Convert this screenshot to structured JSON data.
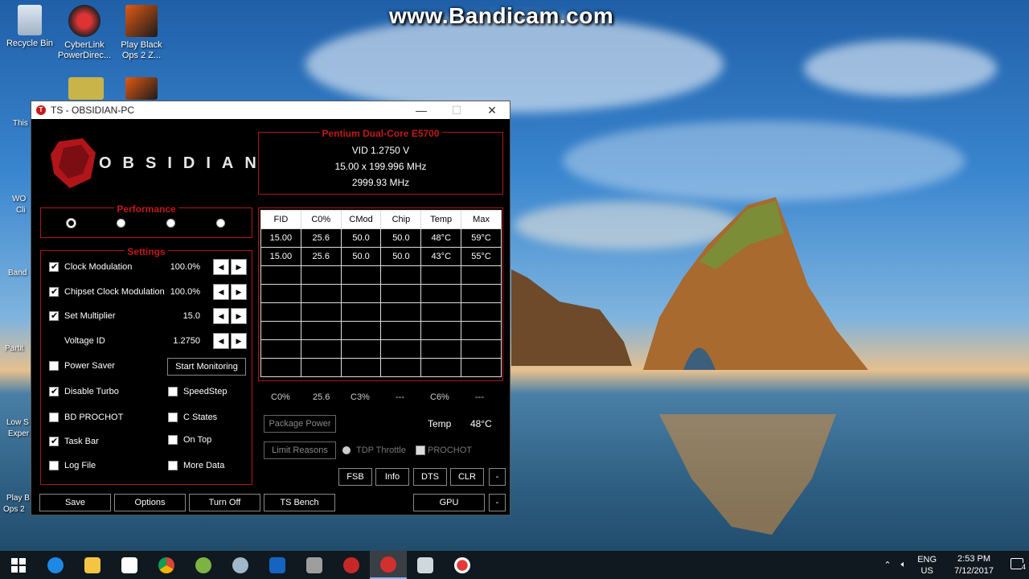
{
  "watermark": "www.Bandicam.com",
  "desktop_icons": [
    {
      "label_line1": "Recycle Bin",
      "label_line2": "",
      "icon": "recycle-bin-icon"
    },
    {
      "label_line1": "CyberLink",
      "label_line2": "PowerDirec...",
      "icon": "cyberlink-icon"
    },
    {
      "label_line1": "Play Black",
      "label_line2": "Ops 2 Z...",
      "icon": "black-ops-icon"
    }
  ],
  "partial_labels": [
    "This",
    "WO",
    "Cli",
    "Band",
    "Partit",
    "Low S",
    "Exper",
    "Play B",
    "Ops 2"
  ],
  "window": {
    "title": "TS - OBSIDIAN-PC",
    "logo_text": "OBSIDIAN",
    "controls": {
      "minimize": "—",
      "maximize": "☐",
      "close": "✕"
    }
  },
  "cpu": {
    "name": "Pentium Dual-Core E5700",
    "vid": "VID  1.2750 V",
    "multiplier": "15.00 x 199.996 MHz",
    "frequency": "2999.93 MHz"
  },
  "performance": {
    "title": "Performance",
    "selected": 0,
    "count": 4
  },
  "settings": {
    "title": "Settings",
    "clock_modulation": {
      "label": "Clock Modulation",
      "value": "100.0%",
      "checked": true
    },
    "chipset_clock_modulation": {
      "label": "Chipset Clock Modulation",
      "value": "100.0%",
      "checked": true
    },
    "set_multiplier": {
      "label": "Set Multiplier",
      "value": "15.0",
      "checked": true
    },
    "voltage_id": {
      "label": "Voltage ID",
      "value": "1.2750"
    },
    "power_saver": {
      "label": "Power Saver",
      "checked": false
    },
    "start_monitoring": "Start Monitoring",
    "disable_turbo": {
      "label": "Disable Turbo",
      "checked": true
    },
    "speedstep": {
      "label": "SpeedStep",
      "checked": false
    },
    "bd_prochot": {
      "label": "BD PROCHOT",
      "checked": false
    },
    "c_states": {
      "label": "C States",
      "checked": false
    },
    "task_bar": {
      "label": "Task Bar",
      "checked": true
    },
    "on_top": {
      "label": "On Top",
      "checked": false
    },
    "log_file": {
      "label": "Log File",
      "checked": false
    },
    "more_data": {
      "label": "More Data",
      "checked": false
    }
  },
  "grid": {
    "headers": [
      "FID",
      "C0%",
      "CMod",
      "Chip",
      "Temp",
      "Max"
    ],
    "rows": [
      [
        "15.00",
        "25.6",
        "50.0",
        "50.0",
        "48°C",
        "59°C"
      ],
      [
        "15.00",
        "25.6",
        "50.0",
        "50.0",
        "43°C",
        "55°C"
      ],
      [
        "",
        "",
        "",
        "",
        "",
        ""
      ],
      [
        "",
        "",
        "",
        "",
        "",
        ""
      ],
      [
        "",
        "",
        "",
        "",
        "",
        ""
      ],
      [
        "",
        "",
        "",
        "",
        "",
        ""
      ],
      [
        "",
        "",
        "",
        "",
        "",
        ""
      ],
      [
        "",
        "",
        "",
        "",
        "",
        ""
      ]
    ]
  },
  "stats": {
    "c0_label": "C0%",
    "c0_value": "25.6",
    "c3_label": "C3%",
    "c3_value": "---",
    "c6_label": "C6%",
    "c6_value": "---",
    "temp_label": "Temp",
    "temp_value": "48°C"
  },
  "buttons": {
    "package_power": "Package Power",
    "limit_reasons": "Limit Reasons",
    "tdp_throttle": "TDP Throttle",
    "prochot": "PROCHOT",
    "fsb": "FSB",
    "info": "Info",
    "dts": "DTS",
    "clr": "CLR",
    "minus": "-",
    "save": "Save",
    "options": "Options",
    "turn_off": "Turn Off",
    "ts_bench": "TS Bench",
    "gpu": "GPU"
  },
  "taskbar": {
    "language_top": "ENG",
    "language_bottom": "US",
    "time": "2:53 PM",
    "date": "7/12/2017",
    "notifications": "4"
  },
  "colors": {
    "accent_red": "#b01818",
    "window_bg": "#000000"
  }
}
